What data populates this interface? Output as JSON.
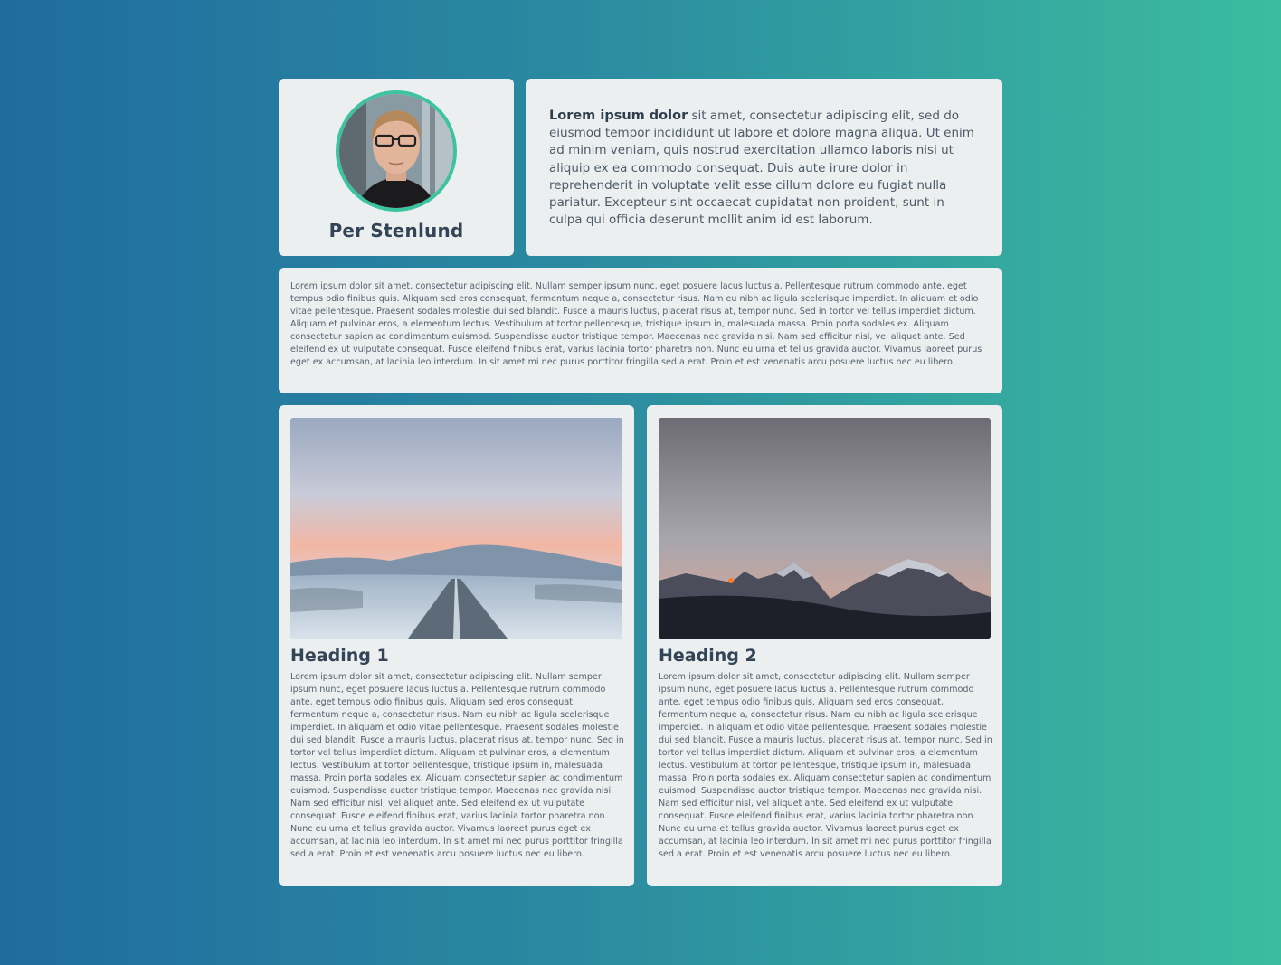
{
  "profile": {
    "name": "Per Stenlund",
    "accent_color": "#3cc3a0"
  },
  "intro": {
    "lead": "Lorem ipsum dolor",
    "text": " sit amet, consectetur adipiscing elit, sed do eiusmod tempor incididunt ut labore et dolore magna aliqua. Ut enim ad minim veniam, quis nostrud exercitation ullamco laboris nisi ut aliquip ex ea commodo consequat. Duis aute irure dolor in reprehenderit in voluptate velit esse cillum dolore eu fugiat nulla pariatur. Excepteur sint occaecat cupidatat non proident, sunt in culpa qui officia deserunt mollit anim id est laborum."
  },
  "paragraph": {
    "text": "Lorem ipsum dolor sit amet, consectetur adipiscing elit. Nullam semper ipsum nunc, eget posuere lacus luctus a. Pellentesque rutrum commodo ante, eget tempus odio finibus quis. Aliquam sed eros consequat, fermentum neque a, consectetur risus. Nam eu nibh ac ligula scelerisque imperdiet. In aliquam et odio vitae pellentesque. Praesent sodales molestie dui sed blandit. Fusce a mauris luctus, placerat risus at, tempor nunc. Sed in tortor vel tellus imperdiet dictum. Aliquam et pulvinar eros, a elementum lectus. Vestibulum at tortor pellentesque, tristique ipsum in, malesuada massa. Proin porta sodales ex. Aliquam consectetur sapien ac condimentum euismod. Suspendisse auctor tristique tempor. Maecenas nec gravida nisi. Nam sed efficitur nisl, vel aliquet ante. Sed eleifend ex ut vulputate consequat. Fusce eleifend finibus erat, varius lacinia tortor pharetra non. Nunc eu urna et tellus gravida auctor. Vivamus laoreet purus eget ex accumsan, at lacinia leo interdum. In sit amet mi nec purus porttitor fringilla sed a erat. Proin et est venenatis arcu posuere luctus nec eu libero."
  },
  "articles": [
    {
      "heading": "Heading 1",
      "text": "Lorem ipsum dolor sit amet, consectetur adipiscing elit. Nullam semper ipsum nunc, eget posuere lacus luctus a. Pellentesque rutrum commodo ante, eget tempus odio finibus quis. Aliquam sed eros consequat, fermentum neque a, consectetur risus. Nam eu nibh ac ligula scelerisque imperdiet. In aliquam et odio vitae pellentesque. Praesent sodales molestie dui sed blandit. Fusce a mauris luctus, placerat risus at, tempor nunc. Sed in tortor vel tellus imperdiet dictum. Aliquam et pulvinar eros, a elementum lectus. Vestibulum at tortor pellentesque, tristique ipsum in, malesuada massa. Proin porta sodales ex. Aliquam consectetur sapien ac condimentum euismod. Suspendisse auctor tristique tempor. Maecenas nec gravida nisi. Nam sed efficitur nisl, vel aliquet ante. Sed eleifend ex ut vulputate consequat. Fusce eleifend finibus erat, varius lacinia tortor pharetra non. Nunc eu urna et tellus gravida auctor. Vivamus laoreet purus eget ex accumsan, at lacinia leo interdum. In sit amet mi nec purus porttitor fringilla sed a erat. Proin et est venenatis arcu posuere luctus nec eu libero."
    },
    {
      "heading": "Heading 2",
      "text": "Lorem ipsum dolor sit amet, consectetur adipiscing elit. Nullam semper ipsum nunc, eget posuere lacus luctus a. Pellentesque rutrum commodo ante, eget tempus odio finibus quis. Aliquam sed eros consequat, fermentum neque a, consectetur risus. Nam eu nibh ac ligula scelerisque imperdiet. In aliquam et odio vitae pellentesque. Praesent sodales molestie dui sed blandit. Fusce a mauris luctus, placerat risus at, tempor nunc. Sed in tortor vel tellus imperdiet dictum. Aliquam et pulvinar eros, a elementum lectus. Vestibulum at tortor pellentesque, tristique ipsum in, malesuada massa. Proin porta sodales ex. Aliquam consectetur sapien ac condimentum euismod. Suspendisse auctor tristique tempor. Maecenas nec gravida nisi. Nam sed efficitur nisl, vel aliquet ante. Sed eleifend ex ut vulputate consequat. Fusce eleifend finibus erat, varius lacinia tortor pharetra non. Nunc eu urna et tellus gravida auctor. Vivamus laoreet purus eget ex accumsan, at lacinia leo interdum. In sit amet mi nec purus porttitor fringilla sed a erat. Proin et est venenatis arcu posuere luctus nec eu libero."
    }
  ],
  "colors": {
    "background_start": "#1f6c9f",
    "background_end": "#3bbc9f",
    "card": "#ebeff0",
    "heading": "#334457"
  }
}
